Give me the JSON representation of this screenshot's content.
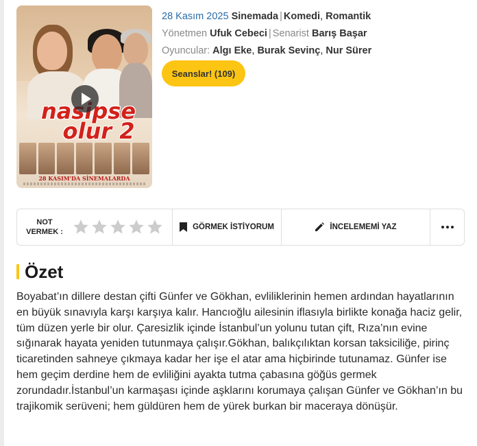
{
  "movie": {
    "release_date": "28 Kasım 2025",
    "release_place": "Sinemada",
    "genres": [
      "Komedi",
      "Romantik"
    ],
    "director_label": "Yönetmen",
    "director": "Ufuk Cebeci",
    "writer_label": "Senarist",
    "writer": "Barış Başar",
    "cast_label": "Oyuncular:",
    "cast": [
      "Algı Eke",
      "Burak Sevinç",
      "Nur Sürer"
    ]
  },
  "poster": {
    "logo_line1": "nasipse",
    "logo_line2": "olur 2",
    "release_banner": "28 KASIM'DA SİNEMALARDA"
  },
  "sessions_button": "Seanslar! (109)",
  "actions": {
    "rate_label_1": "NOT",
    "rate_label_2": "VERMEK :",
    "star_count": 5,
    "watchlist": "GÖRMEK İSTİYORUM",
    "review": "İNCELEMEMİ YAZ",
    "more": "more-options"
  },
  "summary": {
    "title": "Özet",
    "text": "Boyabat’ın dillere destan çifti Günfer ve Gökhan, evliliklerinin hemen ardından hayatlarının en büyük sınavıyla karşı karşıya kalır. Hancıoğlu ailesinin iflasıyla birlikte konağa haciz gelir, tüm düzen yerle bir olur. Çaresizlik içinde İstanbul’un yolunu tutan çift, Rıza’nın evine sığınarak hayata yeniden tutunmaya çalışır.Gökhan, balıkçılıktan korsan taksiciliğe, pirinç ticaretinden sahneye çıkmaya kadar her işe el atar ama hiçbirinde tutunamaz. Günfer ise hem geçim derdine hem de evliliğini ayakta tutma çabasına göğüs germek zorundadır.İstanbul’un karmaşası içinde aşklarını korumaya çalışan Günfer ve Gökhan’ın bu trajikomik serüveni; hem güldüren hem de yürek burkan bir maceraya dönüşür."
  },
  "colors": {
    "accent_yellow": "#fcc514",
    "date_blue": "#2b6ca8",
    "muted_gray": "#888888",
    "star_gray": "#cccccc"
  }
}
